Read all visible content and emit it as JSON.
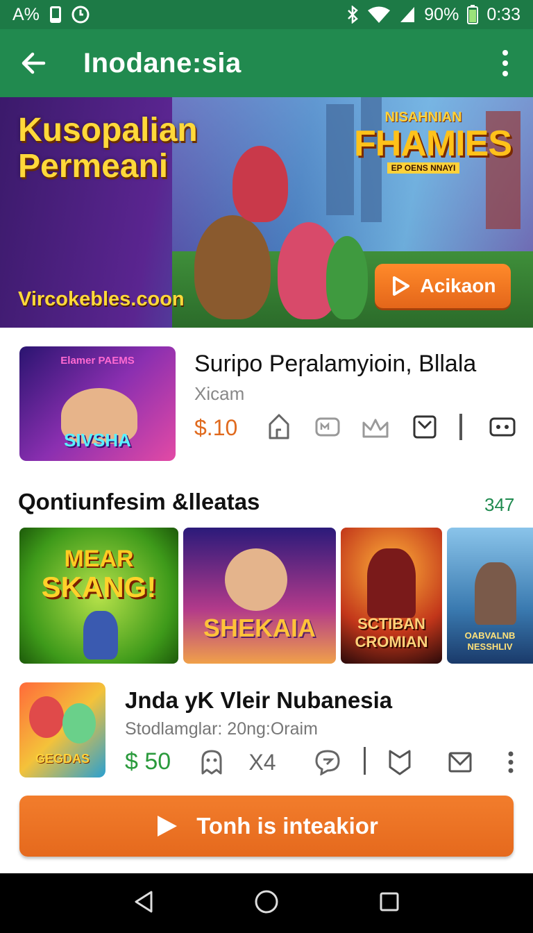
{
  "status_bar": {
    "left_text": "A%",
    "battery_percent": "90%",
    "time": "0:33",
    "icons": [
      "phone-icon",
      "clock-icon",
      "bluetooth-icon",
      "wifi-icon",
      "signal-icon",
      "battery-icon"
    ]
  },
  "app_bar": {
    "title": "Inodane:sia",
    "icons": [
      "back-arrow-icon",
      "more-vert-icon"
    ]
  },
  "banner": {
    "headline_line1": "Kusopalian",
    "headline_line2": "Permeani",
    "site": "Vircokebles.coon",
    "logo_top": "NISAHNIAN",
    "logo_main": "FHAMIES",
    "logo_sub": "EP OENS NNAYI",
    "cta_label": "Acikaon"
  },
  "item1": {
    "title": "Suripo Peɼalamyioin, Bllala",
    "subtitle": "Xicam",
    "price": "$.10",
    "thumb_text_top": "Elamer PAEMS",
    "thumb_text_bottom": "SIVSHA"
  },
  "section": {
    "title": "Qontiunfesim &lleatas",
    "count": "347"
  },
  "gallery": [
    {
      "label_top": "MEAR",
      "label": "SKANG!"
    },
    {
      "label": "SHEKAIA"
    },
    {
      "label": "SCTIBAN CROMIAN"
    },
    {
      "label": "OABVALNB NESSHLIV"
    }
  ],
  "item2": {
    "title": "Jnda yK Vleir Nubanesia",
    "subtitle": "Stodlamglar: 20ng:Oraim",
    "price": "$ 50",
    "count_label": "X4",
    "thumb_text": "GEGDAS"
  },
  "primary_cta": {
    "label": "Tonh is inteakior"
  },
  "colors": {
    "app_bar": "#218a4f",
    "accent_orange": "#e5691d",
    "price_green": "#2a9a3c",
    "section_count": "#1f8a4f"
  }
}
